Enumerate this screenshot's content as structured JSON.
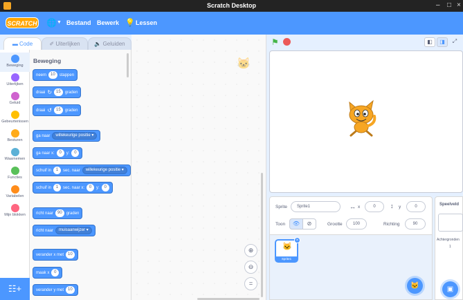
{
  "window": {
    "title": "Scratch Desktop",
    "minimize": "–",
    "maximize": "□",
    "close": "×"
  },
  "menubar": {
    "logo": "SCRATCH",
    "items": [
      "Bestand",
      "Bewerk",
      "Lessen"
    ]
  },
  "tabs": [
    {
      "label": "Code",
      "icon": "code-icon",
      "active": true
    },
    {
      "label": "Uiterlijken",
      "icon": "brush-icon",
      "active": false
    },
    {
      "label": "Geluiden",
      "icon": "speaker-icon",
      "active": false
    }
  ],
  "categories": [
    {
      "label": "Beweging",
      "color": "#4c97ff",
      "active": true
    },
    {
      "label": "Uiterlijken",
      "color": "#9966ff"
    },
    {
      "label": "Geluid",
      "color": "#cf63cf"
    },
    {
      "label": "Gebeurtenissen",
      "color": "#ffbf00"
    },
    {
      "label": "Besturen",
      "color": "#ffab19"
    },
    {
      "label": "Waarnemen",
      "color": "#5cb1d6"
    },
    {
      "label": "Functies",
      "color": "#59c059"
    },
    {
      "label": "Variabelen",
      "color": "#ff8c1a"
    },
    {
      "label": "Mijn blokken",
      "color": "#ff6680"
    }
  ],
  "palette": {
    "heading": "Beweging",
    "blocks": {
      "move": {
        "a": "neem",
        "v": "10",
        "b": "stappen"
      },
      "turn_right": {
        "a": "draai",
        "v": "15",
        "b": "graden"
      },
      "turn_left": {
        "a": "draai",
        "v": "15",
        "b": "graden"
      },
      "goto": {
        "a": "ga naar",
        "d": "willekeurige positie"
      },
      "goto_xy": {
        "a": "ga naar x:",
        "x": "0",
        "m": "y:",
        "y": "0"
      },
      "glide_to": {
        "a": "schuif in",
        "v": "1",
        "b": "sec. naar",
        "d": "willekeurige positie"
      },
      "glide_xy": {
        "a": "schuif in",
        "v": "1",
        "b": "sec. naar x:",
        "x": "0",
        "m": "y:",
        "y": "0"
      },
      "point_dir": {
        "a": "richt naar",
        "v": "90",
        "b": "graden"
      },
      "point_towards": {
        "a": "richt naar",
        "d": "muisaanwijzer"
      },
      "change_x": {
        "a": "verander x met",
        "v": "10"
      },
      "set_x": {
        "a": "maak x",
        "v": "0"
      },
      "change_y": {
        "a": "verander y met",
        "v": "10"
      }
    }
  },
  "sprite_info": {
    "sprite_label": "Sprite",
    "sprite_name": "Sprite1",
    "x_label": "x",
    "x_value": "0",
    "y_label": "y",
    "y_value": "0",
    "show_label": "Toon",
    "size_label": "Grootte",
    "size_value": "100",
    "direction_label": "Richting",
    "direction_value": "90"
  },
  "sprite_list": [
    {
      "name": "Sprite1",
      "selected": true
    }
  ],
  "stage_pane": {
    "label": "Speelveld",
    "backdrops_label": "Achtergronden",
    "backdrops_count": "1"
  }
}
